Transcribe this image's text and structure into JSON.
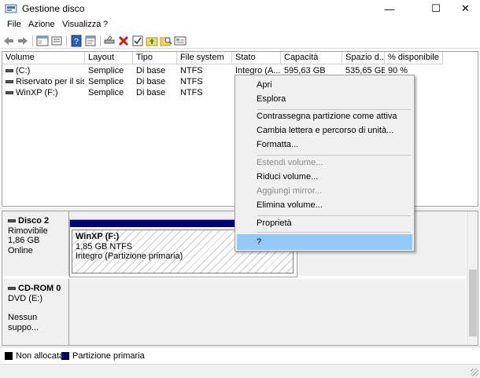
{
  "window": {
    "title": "Gestione disco",
    "min": "—",
    "max": "☐",
    "close": "✕"
  },
  "menu": [
    "File",
    "Azione",
    "Visualizza",
    "?"
  ],
  "columns": [
    "Volume",
    "Layout",
    "Tipo",
    "File system",
    "Stato",
    "Capacità",
    "Spazio d...",
    "% disponibile"
  ],
  "volumes": [
    {
      "name": "(C:)",
      "layout": "Semplice",
      "type": "Di base",
      "fs": "NTFS",
      "status": "Integro (A...",
      "capacity": "595,63 GB",
      "free": "535,65 GB",
      "pct": "90 %"
    },
    {
      "name": "Riservato per il sist...",
      "layout": "Semplice",
      "type": "Di base",
      "fs": "NTFS",
      "status": "",
      "capacity": "",
      "free": "",
      "pct": ""
    },
    {
      "name": "WinXP (F:)",
      "layout": "Semplice",
      "type": "Di base",
      "fs": "NTFS",
      "status": "",
      "capacity": "",
      "free": "",
      "pct": ""
    }
  ],
  "disk2": {
    "name": "Disco 2",
    "kind": "Rimovibile",
    "size": "1,86 GB",
    "state": "Online",
    "partition": {
      "name": "WinXP  (F:)",
      "size": "1,85 GB NTFS",
      "status": "Integro (Partizione primaria)"
    }
  },
  "cdrom": {
    "name": "CD-ROM 0",
    "drive": "DVD (E:)",
    "media": "Nessun suppo..."
  },
  "legend": {
    "unallocated": "Non allocata",
    "primary": "Partizione primaria",
    "primary_color": "#000080"
  },
  "context_menu": {
    "open": "Apri",
    "explore": "Esplora",
    "mark_active": "Contrassegna partizione come attiva",
    "change_letter": "Cambia lettera e percorso di unità...",
    "format": "Formatta...",
    "extend": "Estendi volume...",
    "shrink": "Riduci volume...",
    "add_mirror": "Aggiungi mirror...",
    "delete": "Elimina volume...",
    "properties": "Proprietà",
    "help": "?"
  }
}
